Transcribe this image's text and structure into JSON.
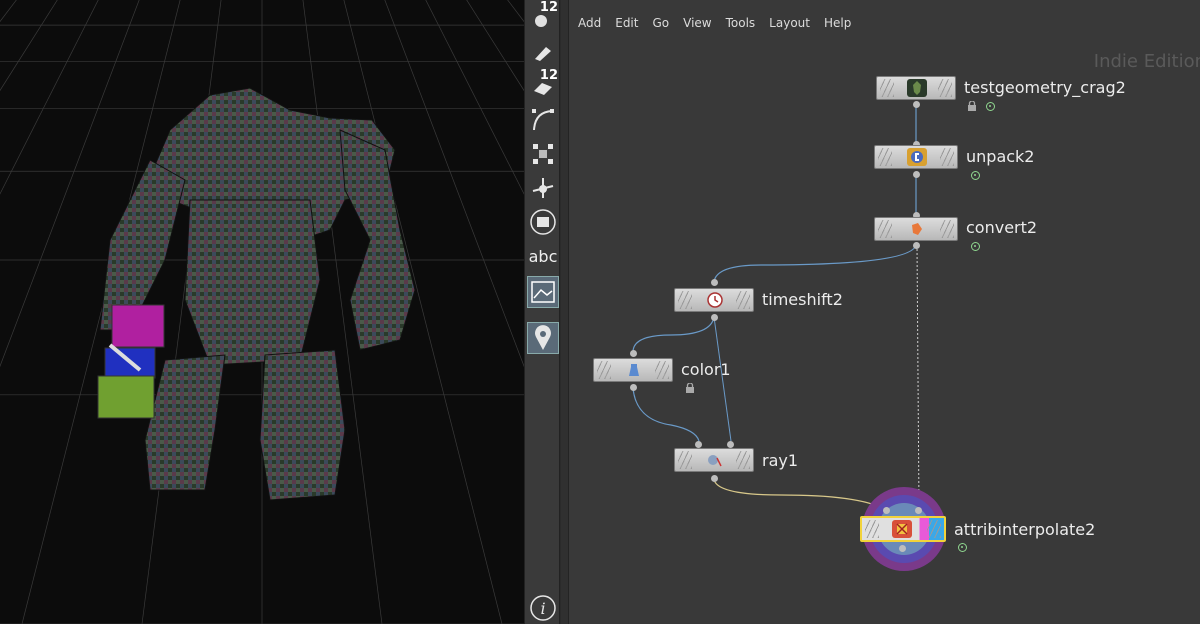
{
  "colors": {
    "viewport_bg": "#0c0c0c",
    "grid": "#3a3a3a",
    "network_bg": "#393939",
    "node_body": "#c8c8c8",
    "label": "#ececec",
    "selected": "#f2d33a",
    "display_flag": "#8fd68f"
  },
  "toolbar": {
    "items": [
      {
        "icon": "sphere-icon",
        "badge": "12"
      },
      {
        "icon": "brush-icon",
        "badge": ""
      },
      {
        "icon": "box-brush-icon",
        "badge": "12"
      },
      {
        "icon": "curve-icon",
        "badge": ""
      },
      {
        "icon": "grid-points-icon",
        "badge": ""
      },
      {
        "icon": "move-point-icon",
        "badge": ""
      },
      {
        "icon": "circle-menu-icon",
        "badge": ""
      },
      {
        "icon": "text-tool",
        "text": "abc"
      },
      {
        "icon": "image-icon",
        "badge": ""
      },
      {
        "icon": "pin-icon",
        "badge": ""
      },
      {
        "icon": "info-icon",
        "badge": ""
      }
    ]
  },
  "menu": [
    "Add",
    "Edit",
    "Go",
    "View",
    "Tools",
    "Layout",
    "Help"
  ],
  "watermark": "Indie Edition",
  "nodes": {
    "testgeometry": {
      "label": "testgeometry_crag2",
      "locked": true,
      "display": true
    },
    "unpack": {
      "label": "unpack2",
      "display": true
    },
    "convert": {
      "label": "convert2",
      "display": true
    },
    "timeshift": {
      "label": "timeshift2"
    },
    "color": {
      "label": "color1",
      "locked": true
    },
    "ray": {
      "label": "ray1"
    },
    "attribinterpolate": {
      "label": "attribinterpolate2",
      "display": true,
      "selected": true
    }
  }
}
